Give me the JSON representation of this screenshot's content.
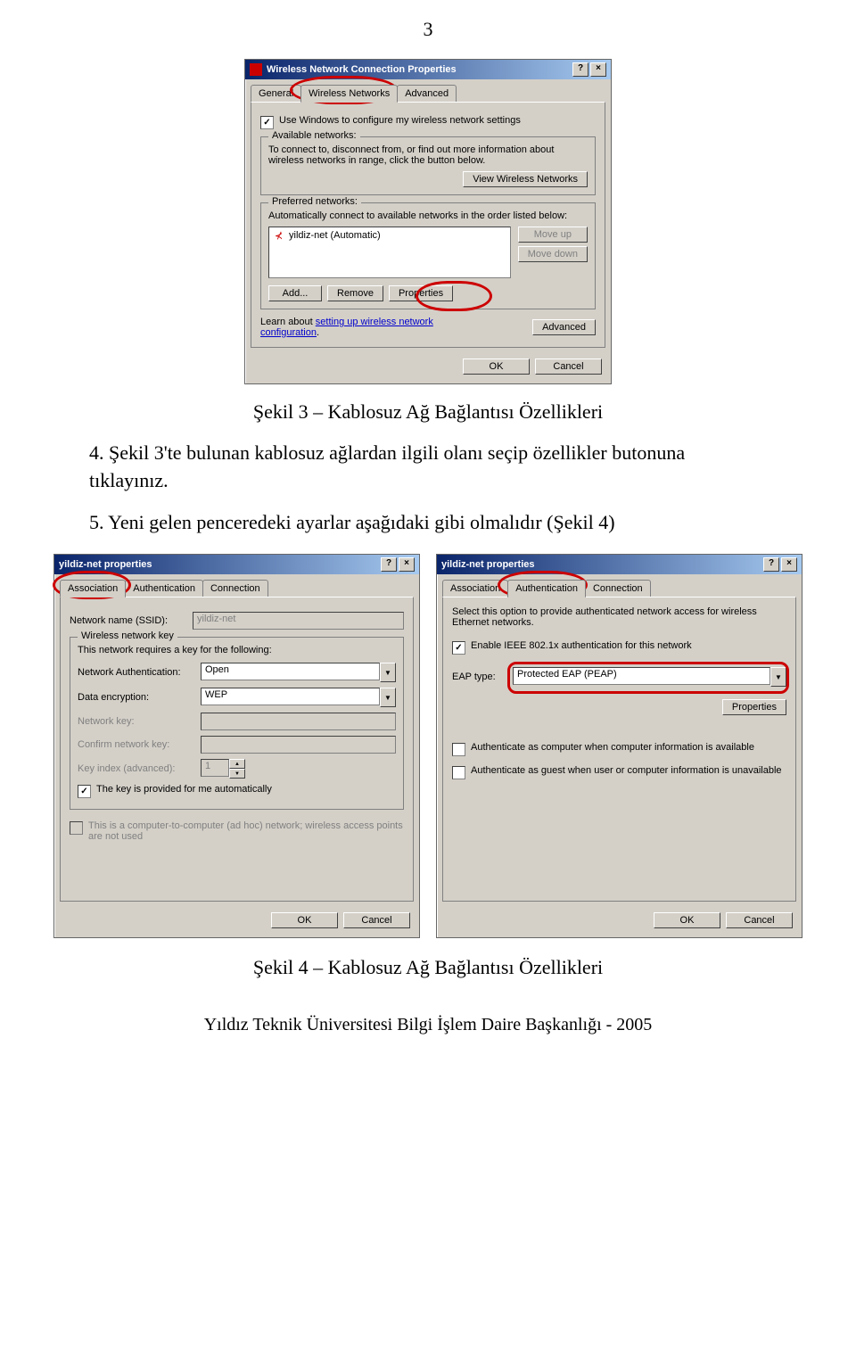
{
  "page_number": "3",
  "dialog1": {
    "title": "Wireless Network Connection Properties",
    "tabs": [
      "General",
      "Wireless Networks",
      "Advanced"
    ],
    "use_windows_check": "Use Windows to configure my wireless network settings",
    "available_legend": "Available networks:",
    "available_desc": "To connect to, disconnect from, or find out more information about wireless networks in range, click the button below.",
    "view_btn": "View Wireless Networks",
    "preferred_legend": "Preferred networks:",
    "preferred_desc": "Automatically connect to available networks in the order listed below:",
    "list_item": "yildiz-net (Automatic)",
    "moveup": "Move up",
    "movedown": "Move down",
    "add": "Add...",
    "remove": "Remove",
    "properties": "Properties",
    "learn": "Learn about ",
    "learn_link": "setting up wireless network configuration",
    "learn_dot": ".",
    "advanced": "Advanced",
    "ok": "OK",
    "cancel": "Cancel"
  },
  "caption1": "Şekil 3 – Kablosuz Ağ Bağlantısı Özellikleri",
  "para1": "4. Şekil 3'te bulunan kablosuz ağlardan ilgili olanı seçip özellikler butonuna tıklayınız.",
  "para2": "5. Yeni gelen penceredeki ayarlar aşağıdaki gibi olmalıdır (Şekil 4)",
  "dialog2": {
    "title": "yildiz-net properties",
    "tabs": [
      "Association",
      "Authentication",
      "Connection"
    ],
    "ssid_label": "Network name (SSID):",
    "ssid_value": "yildiz-net",
    "key_legend": "Wireless network key",
    "key_desc": "This network requires a key for the following:",
    "auth_label": "Network Authentication:",
    "auth_value": "Open",
    "enc_label": "Data encryption:",
    "enc_value": "WEP",
    "netkey_label": "Network key:",
    "confirm_label": "Confirm network key:",
    "index_label": "Key index (advanced):",
    "index_value": "1",
    "autokey": "The key is provided for me automatically",
    "adhoc": "This is a computer-to-computer (ad hoc) network; wireless access points are not used",
    "ok": "OK",
    "cancel": "Cancel"
  },
  "dialog3": {
    "title": "yildiz-net properties",
    "tabs": [
      "Association",
      "Authentication",
      "Connection"
    ],
    "desc": "Select this option to provide authenticated network access for wireless Ethernet networks.",
    "enable": "Enable IEEE 802.1x authentication for this network",
    "eap_label": "EAP type:",
    "eap_value": "Protected EAP (PEAP)",
    "properties": "Properties",
    "auth_comp": "Authenticate as computer when computer information is available",
    "auth_guest": "Authenticate as guest when user or computer information is unavailable",
    "ok": "OK",
    "cancel": "Cancel"
  },
  "caption2": "Şekil 4 – Kablosuz Ağ Bağlantısı Özellikleri",
  "footer": "Yıldız Teknik Üniversitesi Bilgi İşlem Daire Başkanlığı - 2005"
}
